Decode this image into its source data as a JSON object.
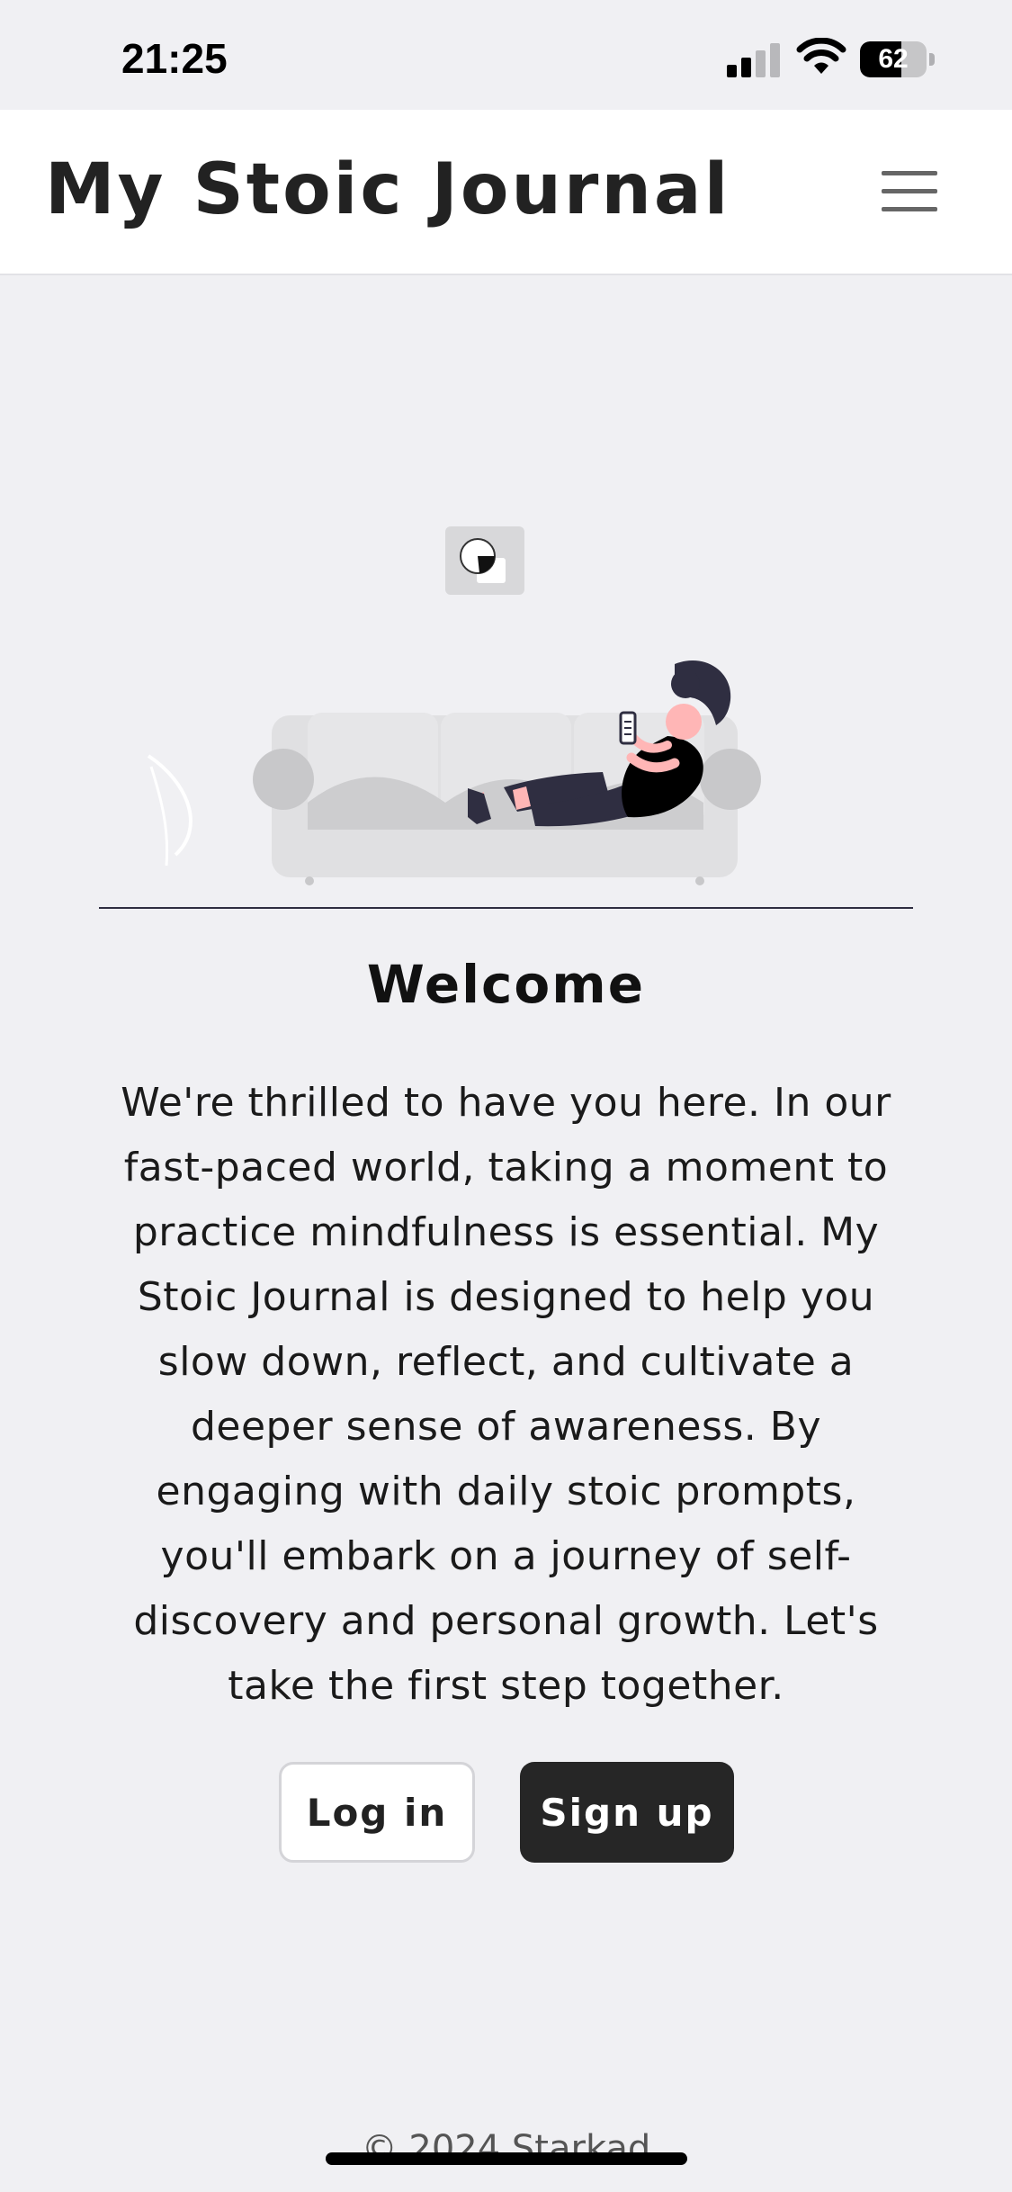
{
  "status_bar": {
    "time": "21:25",
    "battery_level": "62",
    "battery_fraction": 0.62,
    "icons": [
      "signal-icon",
      "wifi-icon",
      "battery-icon"
    ]
  },
  "header": {
    "title": "My Stoic Journal",
    "menu_icon": "hamburger-menu-icon"
  },
  "hero": {
    "illustration": "person-reading-phone-on-sofa",
    "broken_image_icon": "broken-image-icon"
  },
  "main": {
    "heading": "Welcome",
    "body": "We're thrilled to have you here. In our fast-paced world, taking a moment to practice mindfulness is essential. My Stoic Journal is designed to help you slow down, reflect, and cultivate a deeper sense of awareness. By engaging with daily stoic prompts, you'll embark on a journey of self-discovery and personal growth. Let's take the first step together."
  },
  "buttons": {
    "login_label": "Log in",
    "signup_label": "Sign up"
  },
  "footer": {
    "copyright": "© 2024 Starkad"
  },
  "colors": {
    "page_background": "#f0f0f3",
    "header_background": "#ffffff",
    "primary_button": "#262626",
    "sofa": "#e0e0e2",
    "figure_dark": "#2f2e41"
  }
}
